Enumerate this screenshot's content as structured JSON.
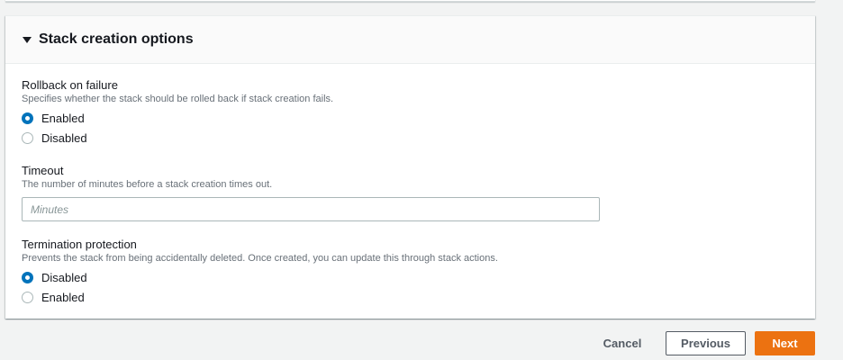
{
  "section": {
    "title": "Stack creation options"
  },
  "rollback": {
    "label": "Rollback on failure",
    "description": "Specifies whether the stack should be rolled back if stack creation fails.",
    "options": [
      "Enabled",
      "Disabled"
    ],
    "selected": "Enabled"
  },
  "timeout": {
    "label": "Timeout",
    "description": "The number of minutes before a stack creation times out.",
    "placeholder": "Minutes",
    "value": ""
  },
  "termination": {
    "label": "Termination protection",
    "description": "Prevents the stack from being accidentally deleted. Once created, you can update this through stack actions.",
    "options": [
      "Disabled",
      "Enabled"
    ],
    "selected": "Disabled"
  },
  "footer": {
    "cancel": "Cancel",
    "previous": "Previous",
    "next": "Next"
  },
  "colors": {
    "accent": "#0073bb",
    "primary": "#ec7211"
  }
}
